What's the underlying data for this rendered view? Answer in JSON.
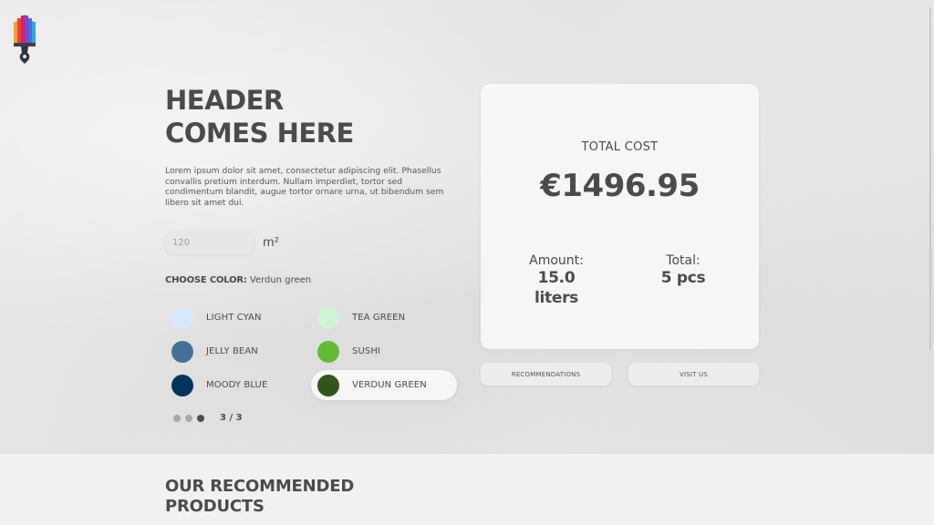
{
  "logo": {
    "icon": "paintbrush-house-logo"
  },
  "hero": {
    "title_line1": "HEADER",
    "title_line2": "COMES HERE",
    "description": "Lorem ipsum dolor sit amet, consectetur adipiscing elit. Phasellus convallis pretium interdum. Nullam imperdiet, tortor sed condimentum blandit, augue tortor ornare urna, ut bibendum sem libero sit amet dui."
  },
  "area_input": {
    "placeholder": "120",
    "value": "",
    "unit": "m²"
  },
  "color_picker": {
    "label": "CHOOSE COLOR:",
    "selected_name": "Verdun green",
    "options": [
      {
        "name": "LIGHT CYAN",
        "color": "#d4e8fc",
        "selected": false
      },
      {
        "name": "TEA GREEN",
        "color": "#cdf3d2",
        "selected": false
      },
      {
        "name": "JELLY BEAN",
        "color": "#44719b",
        "selected": false
      },
      {
        "name": "SUSHI",
        "color": "#62bd35",
        "selected": false
      },
      {
        "name": "MOODY BLUE",
        "color": "#03345f",
        "selected": false
      },
      {
        "name": "VERDUN GREEN",
        "color": "#30561c",
        "selected": true
      }
    ],
    "pager": {
      "current": 3,
      "total": 3,
      "label": "3 / 3"
    }
  },
  "summary": {
    "total_cost_label": "TOTAL COST",
    "total_cost_value": "€1496.95",
    "amount_label": "Amount:",
    "amount_value": "15.0 liters",
    "total_label": "Total:",
    "total_value": "5 pcs"
  },
  "buttons": {
    "recommendations": "RECOMMENDATIONS",
    "visit_us": "VISIT US"
  },
  "recommended": {
    "title_line1": "OUR RECOMMENDED",
    "title_line2": "PRODUCTS"
  }
}
